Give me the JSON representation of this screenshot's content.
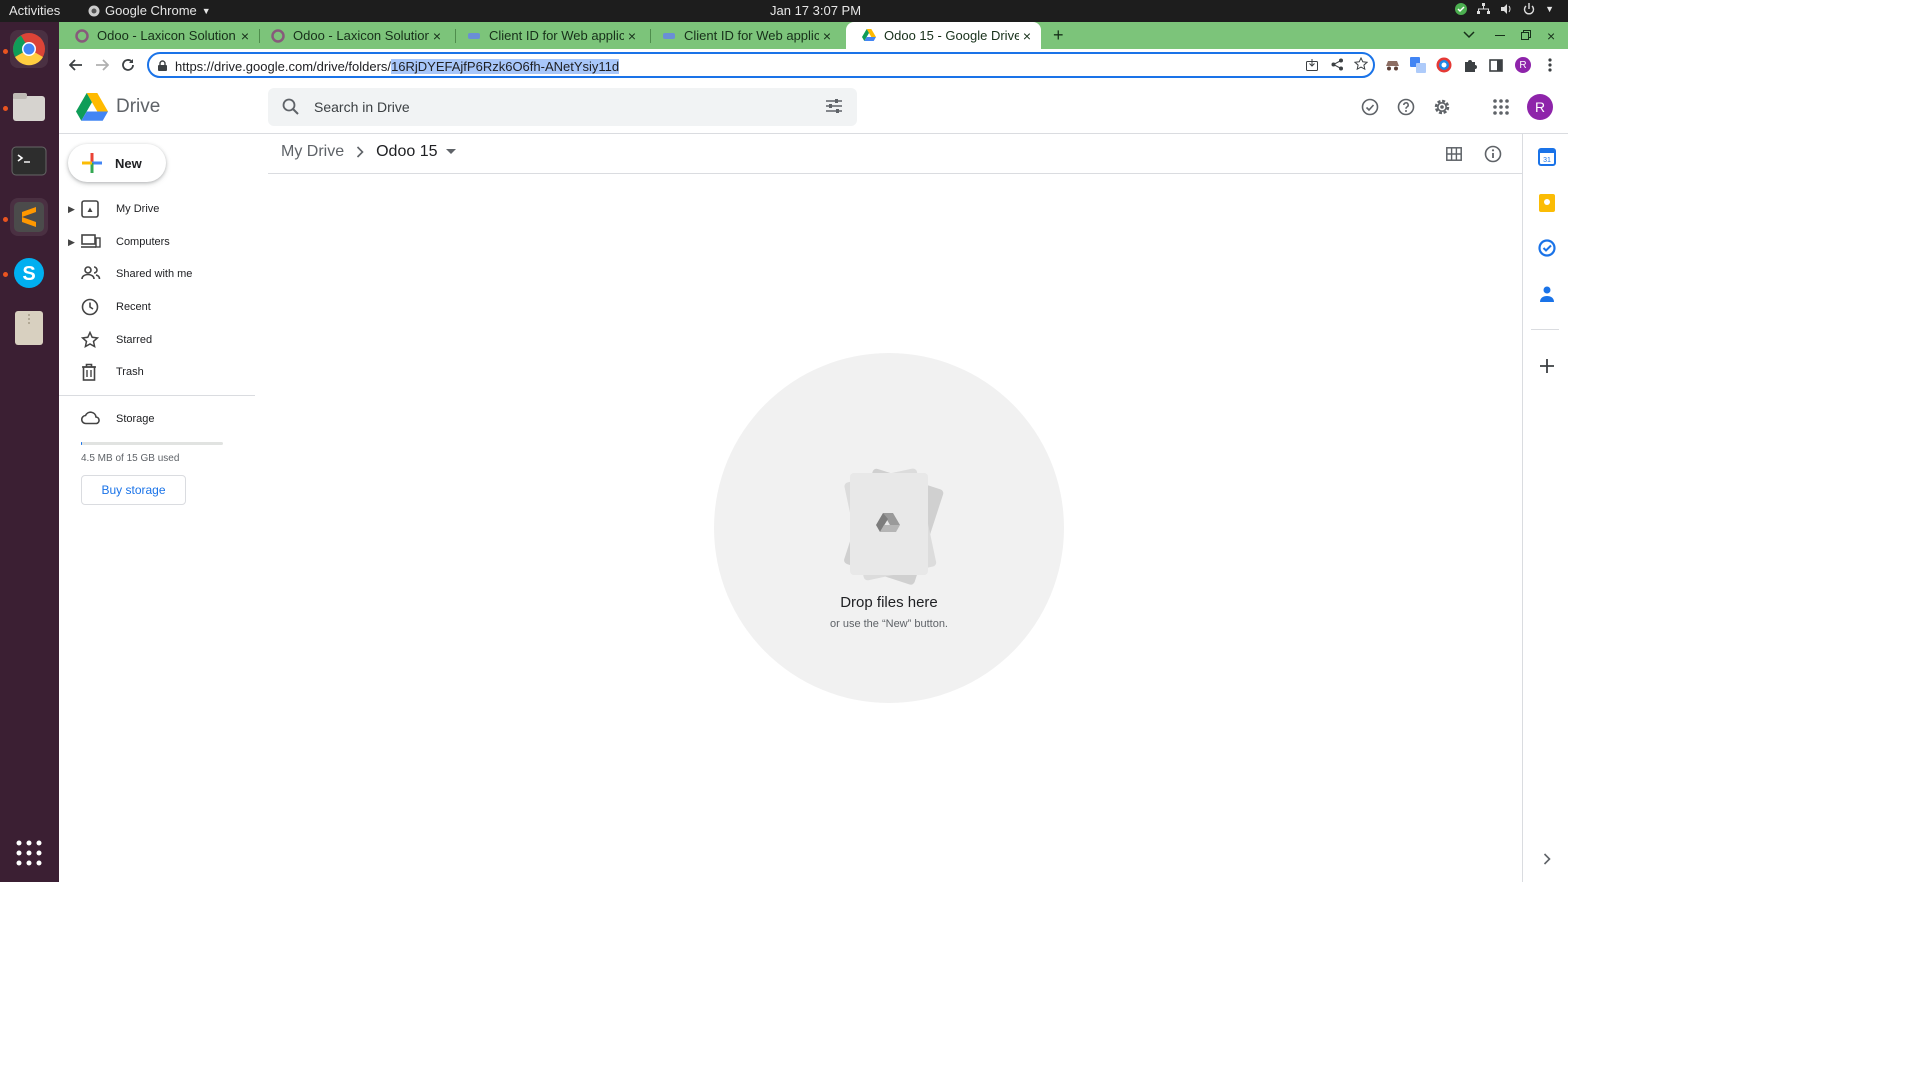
{
  "os": {
    "activities_label": "Activities",
    "app_name": "Google Chrome",
    "clock": "Jan 17  3:07 PM"
  },
  "browser": {
    "tabs": [
      {
        "title": "Odoo - Laxicon Solution",
        "icon": "odoo-icon"
      },
      {
        "title": "Odoo - Laxicon Solution",
        "icon": "odoo-icon"
      },
      {
        "title": "Client ID for Web applicat",
        "icon": "google-cloud-icon"
      },
      {
        "title": "Client ID for Web applicat",
        "icon": "google-cloud-icon"
      },
      {
        "title": "Odoo 15 - Google Drive",
        "icon": "google-drive-icon"
      }
    ],
    "close_glyph": "×",
    "new_tab_glyph": "+",
    "url_base": "https://drive.google.com/drive/folders/",
    "url_selected": "16RjDYEFAjfP6Rzk6O6fh-ANetYsiy11d",
    "profile_initial": "R"
  },
  "drive": {
    "app_title": "Drive",
    "search_placeholder": "Search in Drive",
    "account_initial": "R",
    "new_label": "New",
    "nav": [
      {
        "label": "My Drive",
        "icon": "my-drive-icon"
      },
      {
        "label": "Computers",
        "icon": "computers-icon"
      },
      {
        "label": "Shared with me",
        "icon": "shared-icon"
      },
      {
        "label": "Recent",
        "icon": "clock-icon"
      },
      {
        "label": "Starred",
        "icon": "star-icon"
      },
      {
        "label": "Trash",
        "icon": "trash-icon"
      }
    ],
    "storage_label": "Storage",
    "storage_used": "4.5 MB of 15 GB used",
    "storage_fraction": 0.0003,
    "buy_storage": "Buy storage",
    "breadcrumb": [
      "My Drive",
      "Odoo 15"
    ],
    "empty_title": "Drop files here",
    "empty_subtitle": "or use the “New” button."
  },
  "colors": {
    "accent": "#1a73e8",
    "tab_strip": "#7cc47a",
    "dock": "#3b1f33",
    "account": "#8e24aa"
  }
}
